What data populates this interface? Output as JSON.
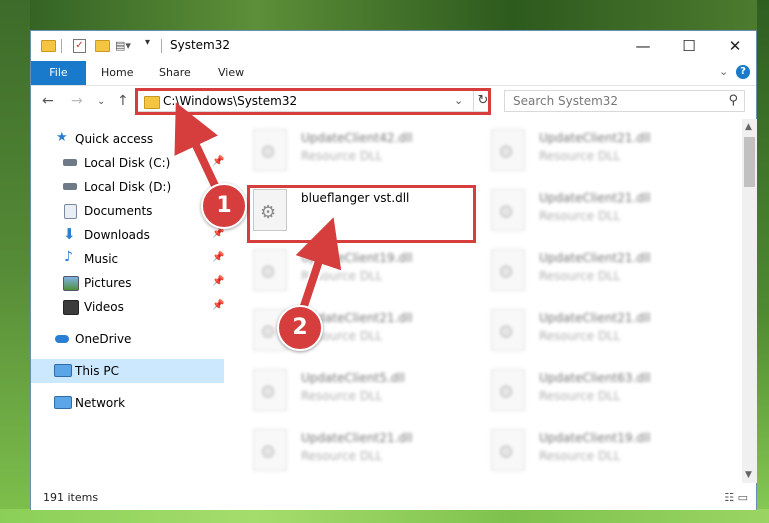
{
  "window": {
    "title": "System32",
    "controls": {
      "minimize": "—",
      "maximize": "☐",
      "close": "✕"
    }
  },
  "ribbon": {
    "file_tab": "File",
    "tabs": [
      "Home",
      "Share",
      "View"
    ],
    "expand_icon": "⌄",
    "help_icon": "?"
  },
  "address": {
    "path": "C:\\Windows\\System32",
    "search_placeholder": "Search System32"
  },
  "nav": {
    "items": [
      {
        "label": "Quick access",
        "icon": "star-icon"
      },
      {
        "label": "Local Disk (C:)",
        "icon": "drive-icon",
        "pinned": true
      },
      {
        "label": "Local Disk (D:)",
        "icon": "drive-icon"
      },
      {
        "label": "Documents",
        "icon": "documents-icon",
        "pinned": true
      },
      {
        "label": "Downloads",
        "icon": "downloads-icon",
        "pinned": true
      },
      {
        "label": "Music",
        "icon": "music-icon",
        "pinned": true
      },
      {
        "label": "Pictures",
        "icon": "pictures-icon",
        "pinned": true
      },
      {
        "label": "Videos",
        "icon": "videos-icon",
        "pinned": true
      },
      {
        "label": "OneDrive",
        "icon": "cloud-icon"
      },
      {
        "label": "This PC",
        "icon": "pc-icon",
        "selected": true
      },
      {
        "label": "Network",
        "icon": "network-icon"
      }
    ]
  },
  "files": {
    "col1": [
      {
        "name": "UpdateClient42.dll",
        "type": "Resource DLL"
      },
      {
        "name": "blueflanger vst.dll",
        "type": ""
      },
      {
        "name": "UpdateClient19.dll",
        "type": "Resource DLL"
      },
      {
        "name": "UpdateClient21.dll",
        "type": "Resource DLL"
      },
      {
        "name": "UpdateClient5.dll",
        "type": "Resource DLL"
      },
      {
        "name": "UpdateClient21.dll",
        "type": "Resource DLL"
      }
    ],
    "col2": [
      {
        "name": "UpdateClient21.dll",
        "type": "Resource DLL"
      },
      {
        "name": "UpdateClient21.dll",
        "type": "Resource DLL"
      },
      {
        "name": "UpdateClient21.dll",
        "type": "Resource DLL"
      },
      {
        "name": "UpdateClient21.dll",
        "type": "Resource DLL"
      },
      {
        "name": "UpdateClient63.dll",
        "type": "Resource DLL"
      },
      {
        "name": "UpdateClient19.dll",
        "type": "Resource DLL"
      }
    ]
  },
  "status": {
    "item_count": "191 items"
  },
  "callouts": {
    "one": "1",
    "two": "2"
  },
  "colors": {
    "accent": "#1979ca",
    "highlight": "#d63d3d",
    "selection": "#cce8ff"
  }
}
